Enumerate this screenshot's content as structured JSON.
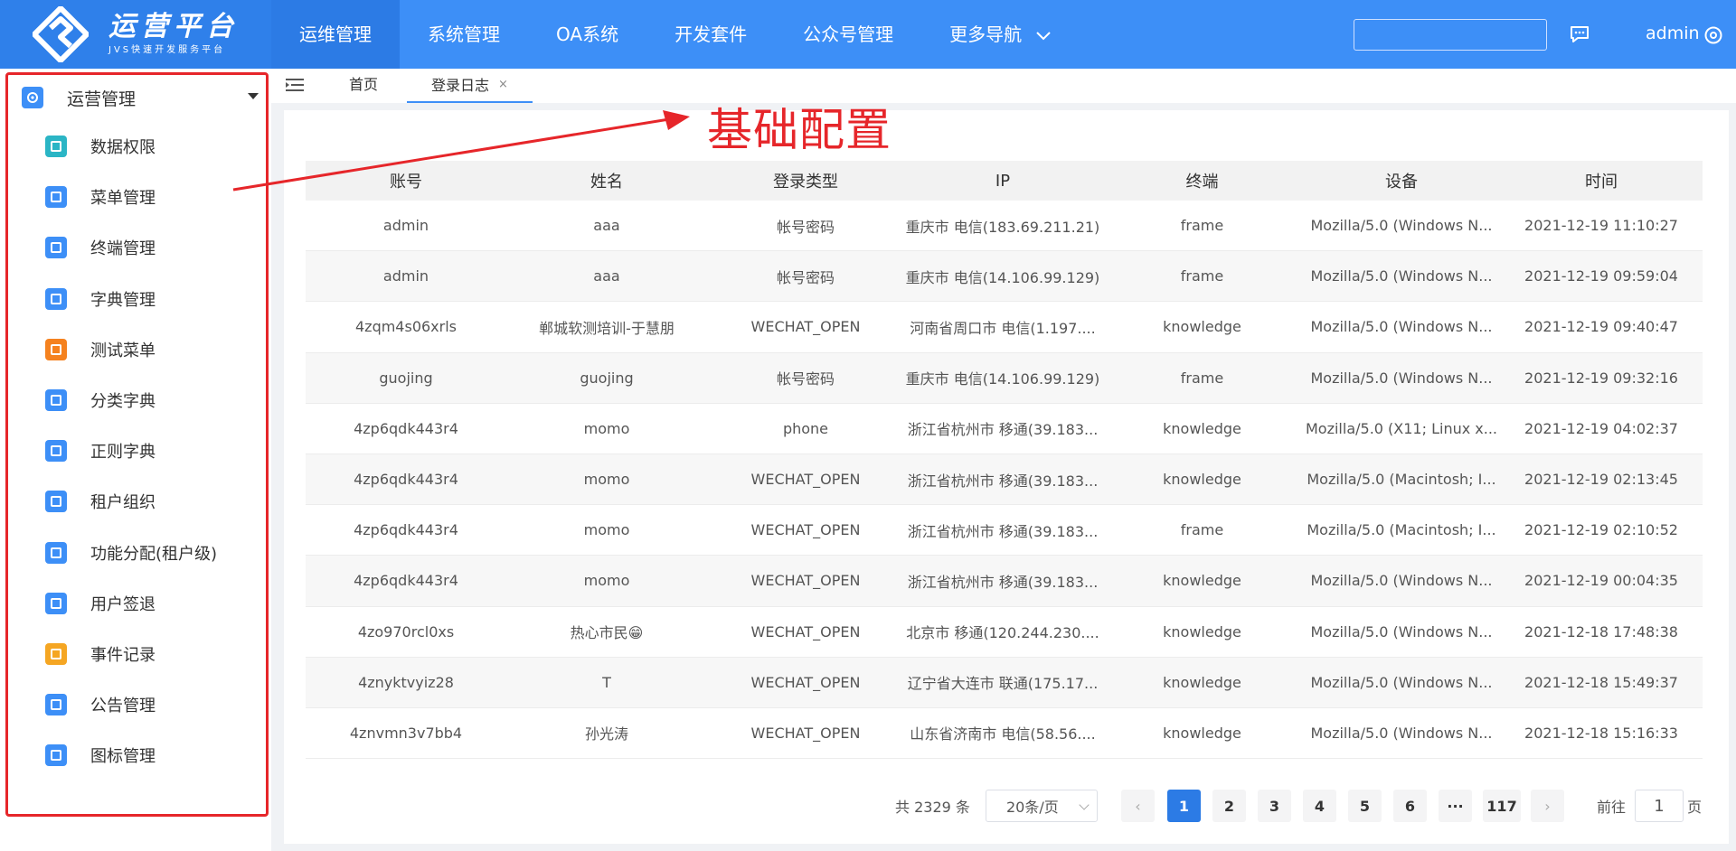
{
  "logo": {
    "title": "运营平台",
    "subtitle": "JVS快速开发服务平台"
  },
  "topnav": [
    "运维管理",
    "系统管理",
    "OA系统",
    "开发套件",
    "公众号管理",
    "更多导航"
  ],
  "user": {
    "name": "admin"
  },
  "sidebar": {
    "group": "运营管理",
    "items": [
      {
        "label": "数据权限",
        "color": "#2bb5c5"
      },
      {
        "label": "菜单管理",
        "color": "#3d8ff7"
      },
      {
        "label": "终端管理",
        "color": "#3d8ff7"
      },
      {
        "label": "字典管理",
        "color": "#3d8ff7"
      },
      {
        "label": "测试菜单",
        "color": "#f5821f"
      },
      {
        "label": "分类字典",
        "color": "#3d8ff7"
      },
      {
        "label": "正则字典",
        "color": "#3d8ff7"
      },
      {
        "label": "租户组织",
        "color": "#3d8ff7"
      },
      {
        "label": "功能分配(租户级)",
        "color": "#3d8ff7"
      },
      {
        "label": "用户签退",
        "color": "#3d8ff7"
      },
      {
        "label": "事件记录",
        "color": "#f5a623"
      },
      {
        "label": "公告管理",
        "color": "#3d8ff7"
      },
      {
        "label": "图标管理",
        "color": "#3d8ff7"
      }
    ]
  },
  "tabs": {
    "home": "首页",
    "active": "登录日志",
    "close": "×"
  },
  "annotation": {
    "label": "基础配置",
    "color": "#e6262a"
  },
  "table": {
    "headers": [
      "账号",
      "姓名",
      "登录类型",
      "IP",
      "终端",
      "设备",
      "时间"
    ],
    "rows": [
      [
        "admin",
        "aaa",
        "帐号密码",
        "重庆市 电信(183.69.211.21)",
        "frame",
        "Mozilla/5.0 (Windows N...",
        "2021-12-19 11:10:27"
      ],
      [
        "admin",
        "aaa",
        "帐号密码",
        "重庆市 电信(14.106.99.129)",
        "frame",
        "Mozilla/5.0 (Windows N...",
        "2021-12-19 09:59:04"
      ],
      [
        "4zqm4s06xrls",
        "郸城软测培训-于慧朋",
        "WECHAT_OPEN",
        "河南省周口市 电信(1.197....",
        "knowledge",
        "Mozilla/5.0 (Windows N...",
        "2021-12-19 09:40:47"
      ],
      [
        "guojing",
        "guojing",
        "帐号密码",
        "重庆市 电信(14.106.99.129)",
        "frame",
        "Mozilla/5.0 (Windows N...",
        "2021-12-19 09:32:16"
      ],
      [
        "4zp6qdk443r4",
        "momo",
        "phone",
        "浙江省杭州市 移通(39.183...",
        "knowledge",
        "Mozilla/5.0 (X11; Linux x...",
        "2021-12-19 04:02:37"
      ],
      [
        "4zp6qdk443r4",
        "momo",
        "WECHAT_OPEN",
        "浙江省杭州市 移通(39.183...",
        "knowledge",
        "Mozilla/5.0 (Macintosh; I...",
        "2021-12-19 02:13:45"
      ],
      [
        "4zp6qdk443r4",
        "momo",
        "WECHAT_OPEN",
        "浙江省杭州市 移通(39.183...",
        "frame",
        "Mozilla/5.0 (Macintosh; I...",
        "2021-12-19 02:10:52"
      ],
      [
        "4zp6qdk443r4",
        "momo",
        "WECHAT_OPEN",
        "浙江省杭州市 移通(39.183...",
        "knowledge",
        "Mozilla/5.0 (Windows N...",
        "2021-12-19 00:04:35"
      ],
      [
        "4zo970rcl0xs",
        "热心市民😁",
        "WECHAT_OPEN",
        "北京市 移通(120.244.230....",
        "knowledge",
        "Mozilla/5.0 (Windows N...",
        "2021-12-18 17:48:38"
      ],
      [
        "4znyktvyiz28",
        "T",
        "WECHAT_OPEN",
        "辽宁省大连市 联通(175.17...",
        "knowledge",
        "Mozilla/5.0 (Windows N...",
        "2021-12-18 15:49:37"
      ],
      [
        "4znvmn3v7bb4",
        "孙光涛",
        "WECHAT_OPEN",
        "山东省济南市 电信(58.56....",
        "knowledge",
        "Mozilla/5.0 (Windows N...",
        "2021-12-18 15:16:33"
      ]
    ]
  },
  "pagination": {
    "total": "共 2329 条",
    "page_size": "20条/页",
    "pages": [
      "1",
      "2",
      "3",
      "4",
      "5",
      "6",
      "···",
      "117"
    ],
    "prev": "‹",
    "next": "›",
    "goto_label": "前往",
    "goto_value": "1",
    "goto_suffix": "页"
  }
}
